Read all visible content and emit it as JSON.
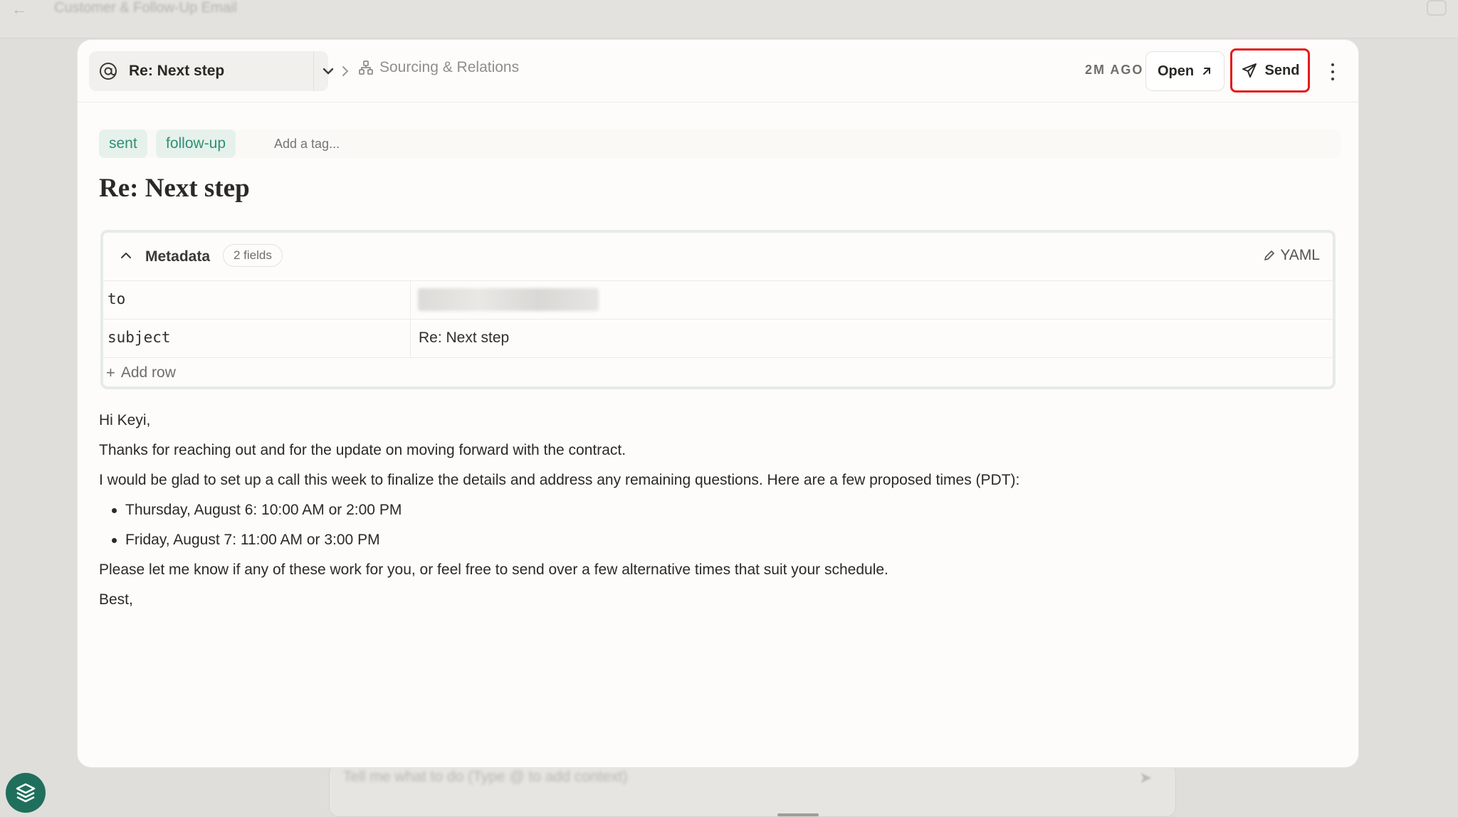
{
  "background": {
    "window_title": "Customer & Follow-Up Email",
    "prompt_placeholder": "Tell me what to do (Type @ to add context)"
  },
  "header": {
    "doc_title": "Re: Next step",
    "breadcrumb": "Sourcing & Relations",
    "time_ago": "2M AGO",
    "open_label": "Open",
    "send_label": "Send"
  },
  "tags": {
    "items": [
      "sent",
      "follow-up"
    ],
    "add_placeholder": "Add a tag..."
  },
  "document": {
    "heading": "Re: Next step"
  },
  "metadata": {
    "label": "Metadata",
    "field_count": "2 fields",
    "yaml_label": "YAML",
    "rows": [
      {
        "key": "to",
        "value": ""
      },
      {
        "key": "subject",
        "value": "Re: Next step"
      }
    ],
    "add_row_label": "Add row"
  },
  "email_body": {
    "greeting": "Hi Keyi,",
    "para1": "Thanks for reaching out and for the update on moving forward with the contract.",
    "para2": "I would be glad to set up a call this week to finalize the details and address any remaining questions. Here are a few proposed times (PDT):",
    "bullets": [
      "Thursday, August 6: 10:00 AM or 2:00 PM",
      "Friday, August 7: 11:00 AM or 3:00 PM"
    ],
    "para3": "Please let me know if any of these work for you, or feel free to send over a few alternative times that suit your schedule.",
    "closing": "Best,"
  },
  "colors": {
    "tag_text": "#2f8f76",
    "tag_bg": "#e6f1ec",
    "send_highlight": "#e21b1b",
    "logo": "#1f6f5c"
  },
  "icons": {
    "doc_type": "at-sign-icon",
    "breadcrumb": "hierarchy-icon",
    "open": "arrow-up-right-icon",
    "send": "paper-plane-icon",
    "more": "kebab-menu-icon",
    "yaml": "pencil-icon"
  }
}
